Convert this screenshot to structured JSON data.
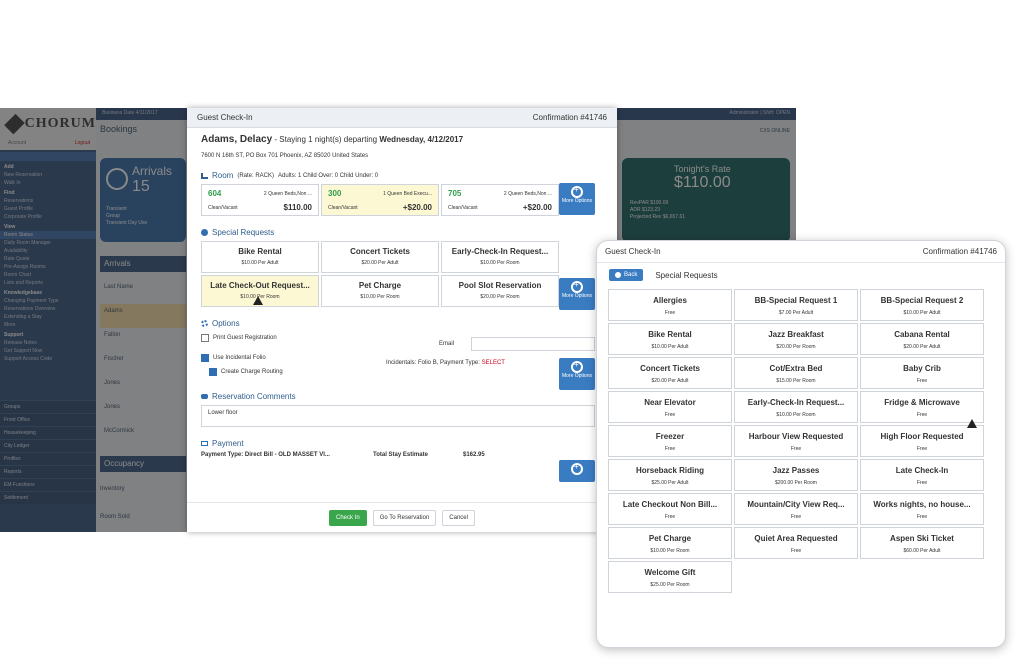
{
  "bg_app": {
    "logo": "CHORUM",
    "account": "Account",
    "logout": "Logout",
    "topbar_left": "Business Date 4/11/2017",
    "topbar_right": "Administrator | Shift: OPEN",
    "bookings": "Bookings",
    "cxs": "CXS ONLINE",
    "sidebar_items": [
      {
        "label": "Add",
        "head": true
      },
      {
        "label": "New Reservation"
      },
      {
        "label": "Walk In"
      },
      {
        "label": "Find",
        "head": true
      },
      {
        "label": "Reservations"
      },
      {
        "label": "Guest Profile"
      },
      {
        "label": "Corporate Profile"
      },
      {
        "label": "View",
        "head": true
      },
      {
        "label": "Room Status",
        "sel": true
      },
      {
        "label": "Daily Room Manager"
      },
      {
        "label": "Availability"
      },
      {
        "label": "Rate Quote"
      },
      {
        "label": "Pre-Assign Rooms"
      },
      {
        "label": "Room Chart"
      },
      {
        "label": "Lists and Reports"
      },
      {
        "label": "Knowledgebase",
        "head": true
      },
      {
        "label": "Changing Payment Type"
      },
      {
        "label": "Reservations Overview"
      },
      {
        "label": "Extending a Stay"
      },
      {
        "label": "More"
      },
      {
        "label": "Support",
        "head": true
      },
      {
        "label": "Release Notes"
      },
      {
        "label": "Get Support Now"
      },
      {
        "label": "Support Access Code"
      }
    ],
    "sidebar_blocks": [
      "Groups",
      "Front Office",
      "Housekeeping",
      "City Ledger",
      "Profiles",
      "Reports",
      "EM Functions",
      "Settlement"
    ],
    "arrivals_title": "Arrivals",
    "arrivals_count": "15",
    "arrivals_lines": [
      "Transient",
      "Group",
      "Transient Day Use"
    ],
    "arrivals_header": "Arrivals",
    "table_rows": [
      "Last Name",
      "Adams",
      "Fallon",
      "Fischer",
      "Jones",
      "Jones",
      "McCormick"
    ],
    "occupancy": "Occupancy",
    "inventory": "Inventory",
    "room_sold": "Room Sold",
    "rate_title": "Tonight's Rate",
    "rate_value": "$110.00",
    "rate_lines": [
      "RevPAR  $100.09",
      "ADR  $123.23",
      "Projected Rev  $6,657.61"
    ]
  },
  "dialog": {
    "title": "Guest Check-In",
    "confirmation": "Confirmation #41746",
    "guest_name": "Adams, Delacy",
    "stay_text": " - Staying 1 night(s) departing ",
    "depart_date": "Wednesday, 4/12/2017",
    "address": "7600 N 16th ST, PO Box 701 Phoenix, AZ 85020 United States",
    "room_section": "Room",
    "room_rate": "(Rate: RACK)",
    "room_occupancy": "Adults: 1 Child Over: 0 Child Under: 0",
    "rooms": [
      {
        "num": "604",
        "type": "2 Queen Beds,Non ...",
        "status": "Clean/Vacant",
        "price": "$110.00",
        "sel": false
      },
      {
        "num": "300",
        "type": "1 Queen Bed Execu...",
        "status": "Clean/Vacant",
        "price": "+$20.00",
        "sel": true
      },
      {
        "num": "705",
        "type": "2 Queen Beds,Non ...",
        "status": "Clean/Vacant",
        "price": "+$20.00",
        "sel": false
      }
    ],
    "more_options": "More Options",
    "special_section": "Special Requests",
    "special": [
      {
        "name": "Bike Rental",
        "sub": "$10.00 Per Adult",
        "sel": false
      },
      {
        "name": "Concert Tickets",
        "sub": "$20.00 Per Adult",
        "sel": false
      },
      {
        "name": "Early-Check-In Request...",
        "sub": "$10.00 Per Room",
        "sel": false
      },
      {
        "name": "Late Check-Out Request...",
        "sub": "$10.00 Per Room",
        "sel": true
      },
      {
        "name": "Pet Charge",
        "sub": "$10.00 Per Room",
        "sel": false
      },
      {
        "name": "Pool Slot Reservation",
        "sub": "$20.00 Per Room",
        "sel": false
      }
    ],
    "options_section": "Options",
    "print_reg": "Print Guest Registration",
    "email_label": "Email",
    "use_folio": "Use Incidental Folio",
    "charge_routing": "Create Charge Routing",
    "incidentals": "Incidentals: Folio B, Payment Type: ",
    "incidentals_select": "SELECT",
    "comments_section": "Reservation Comments",
    "comment": "Lower floor",
    "payment_section": "Payment",
    "payment_type": "Payment Type: Direct Bill - OLD MASSET VI...",
    "total_label": "Total Stay Estimate",
    "total_value": "$162.95",
    "btn_checkin": "Check In",
    "btn_goto": "Go To Reservation",
    "btn_cancel": "Cancel"
  },
  "panel": {
    "title": "Guest Check-In",
    "confirmation": "Confirmation #41746",
    "back": "Back",
    "section": "Special Requests",
    "items": [
      {
        "name": "Allergies",
        "sub": "Free"
      },
      {
        "name": "BB-Special Request 1",
        "sub": "$7.00 Per Adult"
      },
      {
        "name": "BB-Special Request 2",
        "sub": "$10.00 Per Adult"
      },
      {
        "name": "Bike Rental",
        "sub": "$10.00 Per Adult"
      },
      {
        "name": "Jazz Breakfast",
        "sub": "$20.00 Per Room"
      },
      {
        "name": "Cabana Rental",
        "sub": "$20.00 Per Adult"
      },
      {
        "name": "Concert Tickets",
        "sub": "$20.00 Per Adult"
      },
      {
        "name": "Cot/Extra Bed",
        "sub": "$15.00 Per Room"
      },
      {
        "name": "Baby Crib",
        "sub": "Free"
      },
      {
        "name": "Near Elevator",
        "sub": "Free"
      },
      {
        "name": "Early-Check-In Request...",
        "sub": "$10.00 Per Room"
      },
      {
        "name": "Fridge & Microwave",
        "sub": "Free"
      },
      {
        "name": "Freezer",
        "sub": "Free"
      },
      {
        "name": "Harbour View Requested",
        "sub": "Free"
      },
      {
        "name": "High Floor Requested",
        "sub": "Free"
      },
      {
        "name": "Horseback Riding",
        "sub": "$25.00 Per Adult"
      },
      {
        "name": "Jazz Passes",
        "sub": "$200.00 Per Room"
      },
      {
        "name": "Late Check-In",
        "sub": "Free"
      },
      {
        "name": "Late Checkout Non Bill...",
        "sub": "Free"
      },
      {
        "name": "Mountain/City View Req...",
        "sub": "Free"
      },
      {
        "name": "Works nights, no house...",
        "sub": "Free"
      },
      {
        "name": "Pet Charge",
        "sub": "$10.00 Per Room"
      },
      {
        "name": "Quiet Area Requested",
        "sub": "Free"
      },
      {
        "name": "Aspen Ski Ticket",
        "sub": "$60.00 Per Adult"
      },
      {
        "name": "Welcome Gift",
        "sub": "$25.00 Per Room"
      }
    ]
  }
}
